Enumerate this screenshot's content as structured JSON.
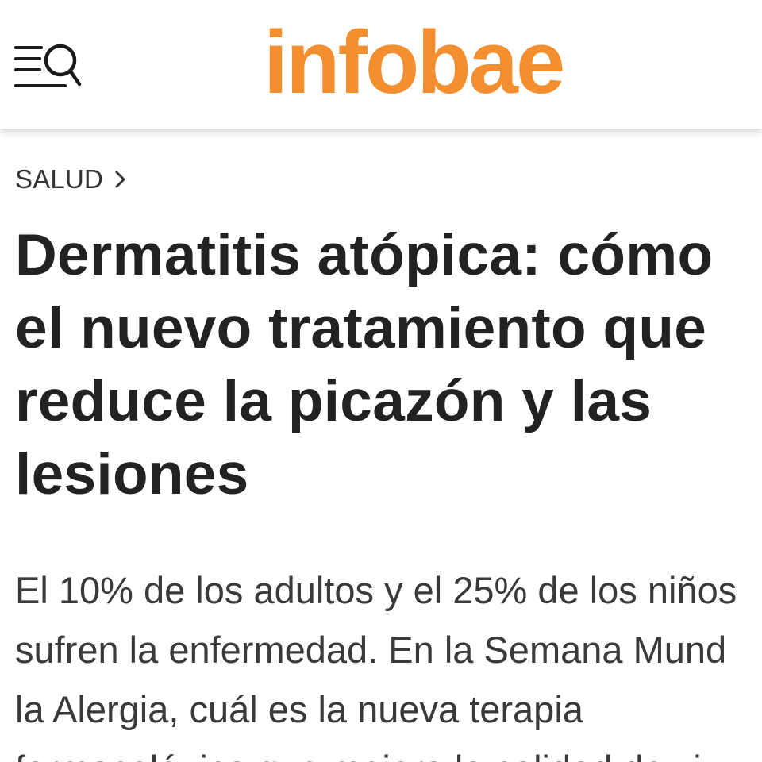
{
  "header": {
    "menu_search_icon": "menu-search-icon",
    "logo_text": "infobae",
    "brand_color": "#f38f2f"
  },
  "breadcrumb": {
    "section": "SALUD",
    "chevron_icon": "chevron-right-icon"
  },
  "article": {
    "headline_lines": [
      "Dermatitis atópica: cómo",
      "el nuevo tratamiento que",
      "reduce la picazón y las",
      "lesiones"
    ],
    "summary_lines": [
      "El 10% de los adultos y el 25% de los niños",
      "sufren la enfermedad. En la Semana Mund",
      "la Alergia, cuál es la nueva terapia",
      "farmacológica que mejora la calidad de vi"
    ]
  }
}
